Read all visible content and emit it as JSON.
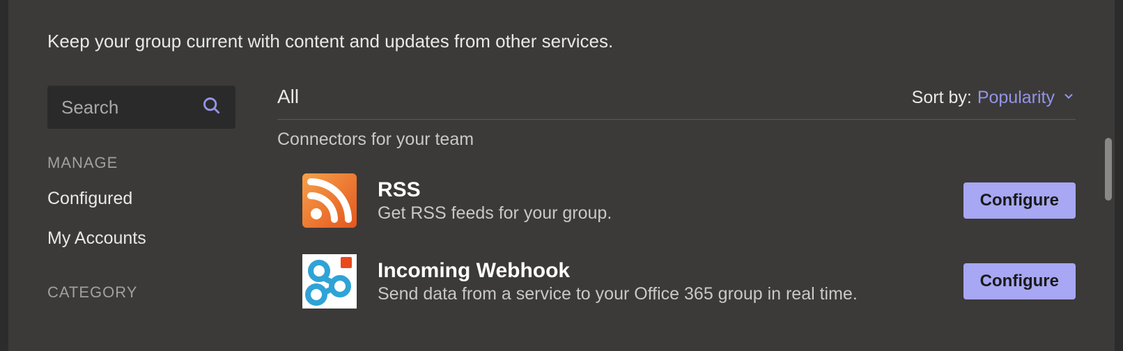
{
  "subtitle": "Keep your group current with content and updates from other services.",
  "search": {
    "placeholder": "Search"
  },
  "sidebar": {
    "manage_label": "MANAGE",
    "nav_items": [
      {
        "label": "Configured"
      },
      {
        "label": "My Accounts"
      }
    ],
    "category_label": "CATEGORY"
  },
  "main": {
    "filter": "All",
    "sort_label": "Sort by:",
    "sort_value": "Popularity",
    "list_heading": "Connectors for your team",
    "connectors": [
      {
        "icon": "rss-icon",
        "title": "RSS",
        "description": "Get RSS feeds for your group.",
        "button": "Configure"
      },
      {
        "icon": "webhook-icon",
        "title": "Incoming Webhook",
        "description": "Send data from a service to your Office 365 group in real time.",
        "button": "Configure"
      }
    ]
  }
}
